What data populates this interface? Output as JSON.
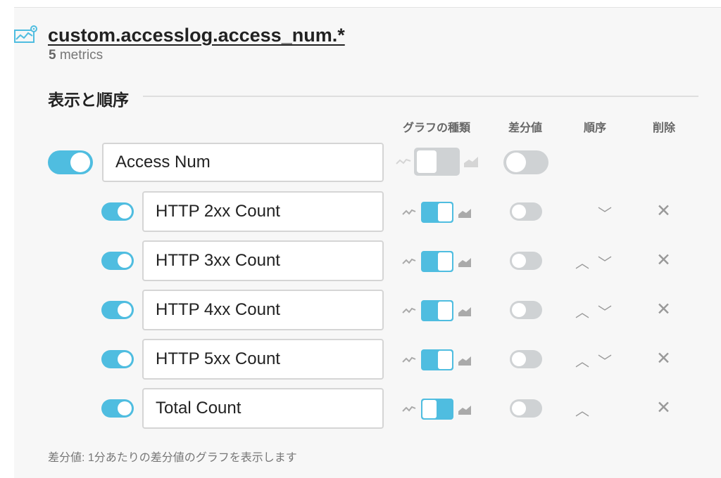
{
  "metric": {
    "title": "custom.accesslog.access_num.*",
    "count": "5",
    "count_suffix": "metrics"
  },
  "section": {
    "title": "表示と順序",
    "columns": {
      "graph_type": "グラフの種類",
      "diff": "差分値",
      "order": "順序",
      "delete": "削除"
    }
  },
  "group": {
    "name": "Access Num",
    "visible": true,
    "graph_type": "line",
    "diff": false
  },
  "rows": [
    {
      "name": "HTTP 2xx Count",
      "visible": true,
      "graph_type": "stacked",
      "diff": false,
      "up": false,
      "down": true
    },
    {
      "name": "HTTP 3xx Count",
      "visible": true,
      "graph_type": "stacked",
      "diff": false,
      "up": true,
      "down": true
    },
    {
      "name": "HTTP 4xx Count",
      "visible": true,
      "graph_type": "stacked",
      "diff": false,
      "up": true,
      "down": true
    },
    {
      "name": "HTTP 5xx Count",
      "visible": true,
      "graph_type": "stacked",
      "diff": false,
      "up": true,
      "down": true
    },
    {
      "name": "Total Count",
      "visible": true,
      "graph_type": "line",
      "diff": false,
      "up": true,
      "down": false
    }
  ],
  "glyphs": {
    "up": "︿",
    "down": "﹀",
    "delete": "✕"
  },
  "icons": {
    "chart": "chart-settings-icon",
    "line": "line-chart-icon",
    "area": "area-chart-icon"
  },
  "colors": {
    "accent": "#4fbde0",
    "toggle_off": "#cfd2d4"
  },
  "footnote": "差分値: 1分あたりの差分値のグラフを表示します"
}
